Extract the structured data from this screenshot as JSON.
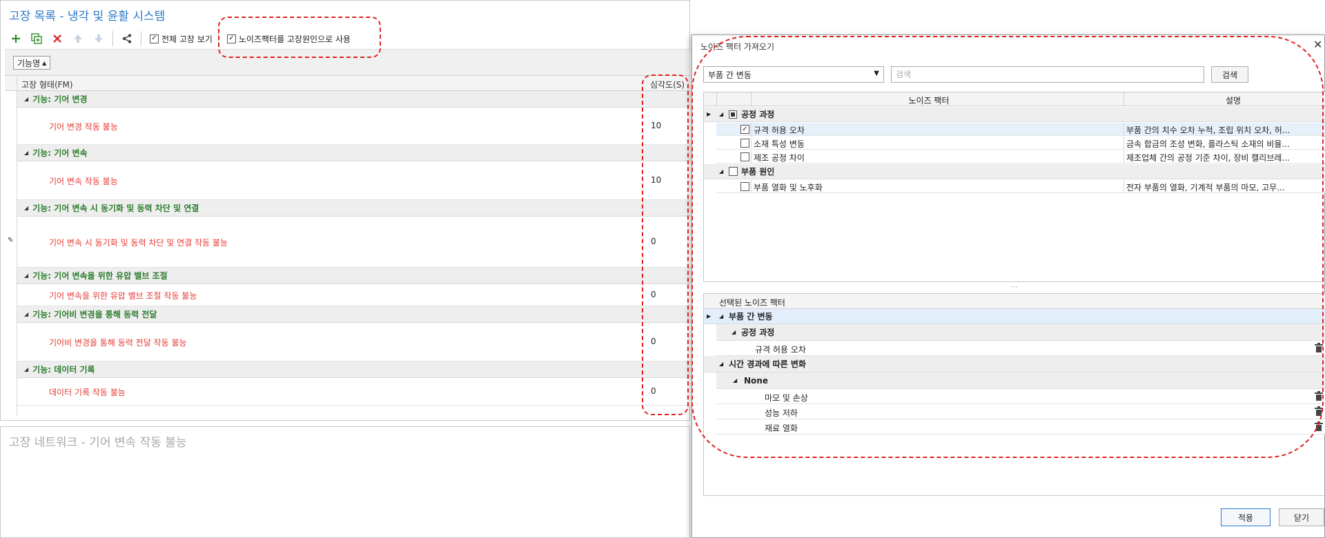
{
  "main": {
    "title": "고장 목록 - 냉각 및 윤활 시스템",
    "toolbar": {
      "show_all_label": "전체 고장 보기",
      "noise_as_cause_label": "노이즈팩터를 고장원인으로 사용",
      "icons": [
        "plus-icon",
        "copy-icon",
        "delete-icon",
        "move-up-icon",
        "move-down-icon",
        "share-icon"
      ]
    },
    "group_by": "기능명",
    "columns": {
      "fm": "고장 형태(FM)",
      "severity": "심각도(S)"
    },
    "groups": [
      {
        "label": "기능: 기어 변경",
        "fm": "기어 변경 작동 불능",
        "severity": "10"
      },
      {
        "label": "기능: 기어 변속",
        "fm": "기어 변속 작동 불능",
        "severity": "10"
      },
      {
        "label": "기능: 기어 변속 시 동기화 및 동력 차단 및 연결",
        "fm": "기어 변속 시 동기화 및 동력 차단 및 연결 작동 불능",
        "severity": "0"
      },
      {
        "label": "기능: 기어 변속을 위한 유압 밸브 조절",
        "fm": "기어 변속을 위한 유압 밸브 조절 작동 불능",
        "severity": "0"
      },
      {
        "label": "기능: 기어비 변경을 통해 동력 전달",
        "fm": "기어비 변경을 통해 동력 전달 작동 불능",
        "severity": "0"
      },
      {
        "label": "기능: 데이터 기록",
        "fm": "데이터 기록 작동 불능",
        "severity": "0"
      }
    ]
  },
  "network": {
    "title": "고장 네트워크 - 기어 변속 작동 불능"
  },
  "dialog": {
    "title": "노이즈 팩터 가져오기",
    "category": "부품 간 변동",
    "search_placeholder": "검색",
    "search_button": "검색",
    "columns": {
      "factor": "노이즈 팩터",
      "description": "설명"
    },
    "categories": [
      {
        "name": "공정 과정",
        "items": [
          {
            "name": "규격 허용 오차",
            "description": "부품 간의 치수 오차 누적, 조립 위치 오차, 허...",
            "checked": true
          },
          {
            "name": "소재 특성 변동",
            "description": "금속 합금의 조성 변화, 플라스틱 소재의 비율...",
            "checked": false
          },
          {
            "name": "제조 공정 차이",
            "description": "제조업체 간의 공정 기준 차이, 장비 캘리브레...",
            "checked": false
          }
        ]
      },
      {
        "name": "부품 원인",
        "items": [
          {
            "name": "부품 열화 및 노후화",
            "description": "전자 부품의 열화, 기계적 부품의 마모, 고무...",
            "checked": false
          }
        ]
      }
    ],
    "selected_header": "선택된 노이즈 팩터",
    "selected": {
      "root": "부품 간 변동",
      "group1": "공정 과정",
      "group1_items": [
        "규격 허용 오차"
      ],
      "group2": "시간 경과에 따른 변화",
      "group2_sub": "None",
      "group2_items": [
        "마모 및 손상",
        "성능 저하",
        "재료 열화"
      ]
    },
    "apply_label": "적용",
    "close_label": "닫기"
  },
  "colors": {
    "accent": "#2a77c9",
    "function_group": "#2d7d2d",
    "failure_mode": "#e53935",
    "annotation": "#e02020"
  }
}
